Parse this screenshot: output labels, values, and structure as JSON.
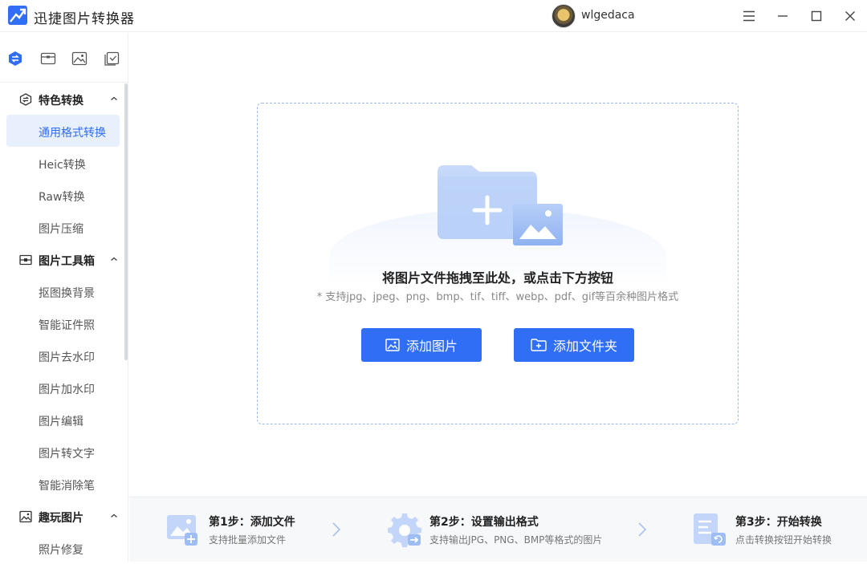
{
  "app": {
    "title": "迅捷图片转换器",
    "username": "wlgedaca"
  },
  "window_controls": [
    "menu-icon",
    "minimize-icon",
    "maximize-icon",
    "close-icon"
  ],
  "sidebar": {
    "tabs": [
      "convert-icon",
      "toolbox-icon",
      "image-icon",
      "check-copy-icon"
    ],
    "sections": [
      {
        "label": "特色转换",
        "icon": "convert-icon",
        "expanded": true,
        "items": [
          "通用格式转换",
          "Heic转换",
          "Raw转换",
          "图片压缩"
        ]
      },
      {
        "label": "图片工具箱",
        "icon": "toolbox-icon",
        "expanded": true,
        "items": [
          "抠图换背景",
          "智能证件照",
          "图片去水印",
          "图片加水印",
          "图片编辑",
          "图片转文字",
          "智能消除笔"
        ]
      },
      {
        "label": "趣玩图片",
        "icon": "image-icon",
        "expanded": true,
        "items": [
          "照片修复"
        ]
      }
    ],
    "active_item": "通用格式转换"
  },
  "dropzone": {
    "title": "将图片文件拖拽至此处，或点击下方按钮",
    "subtitle": "* 支持jpg、jpeg、png、bmp、tif、tiff、webp、pdf、gif等百余种图片格式",
    "add_image_label": "添加图片",
    "add_folder_label": "添加文件夹"
  },
  "steps": [
    {
      "title": "第1步：添加文件",
      "desc": "支持批量添加文件"
    },
    {
      "title": "第2步：设置输出格式",
      "desc": "支持输出JPG、PNG、BMP等格式的图片"
    },
    {
      "title": "第3步：开始转换",
      "desc": "点击转换按钮开始转换"
    }
  ],
  "colors": {
    "accent": "#2f6ef5",
    "active_bg": "#e8effd",
    "dashed_border": "#9db8ee"
  }
}
